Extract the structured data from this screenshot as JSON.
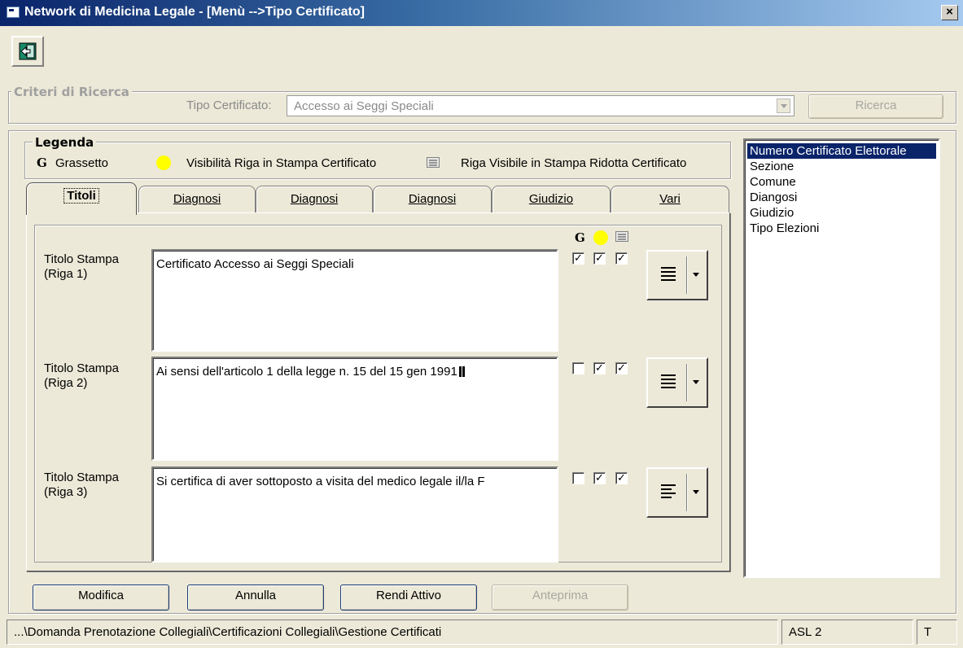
{
  "window": {
    "title": "Network di Medicina Legale - [Menù -->Tipo Certificato]",
    "close_label": "×"
  },
  "toolbar": {
    "exit_icon": "exit-door-icon"
  },
  "search": {
    "group_label": "Criteri di Ricerca",
    "tipo_label": "Tipo Certificato:",
    "tipo_value": "Accesso ai Seggi Speciali",
    "search_button": "Ricerca"
  },
  "legenda": {
    "title": "Legenda",
    "g_symbol": "G",
    "g_text": "Grassetto",
    "visible_text": "Visibilità Riga in Stampa Certificato",
    "reduced_text": "Riga Visibile in Stampa Ridotta Certificato"
  },
  "tabs": [
    {
      "label": "Titoli",
      "active": true
    },
    {
      "label": "Diagnosi",
      "active": false
    },
    {
      "label": "Diagnosi",
      "active": false
    },
    {
      "label": "Diagnosi",
      "active": false
    },
    {
      "label": "Giudizio",
      "active": false
    },
    {
      "label": "Vari",
      "active": false
    }
  ],
  "column_header": {
    "g": "G"
  },
  "rows": [
    {
      "label_line1": "Titolo Stampa",
      "label_line2": "(Riga 1)",
      "text": "Certificato Accesso ai Seggi Speciali",
      "bold_checked": true,
      "visible_checked": true,
      "reduced_checked": true,
      "alignment": "justify"
    },
    {
      "label_line1": "Titolo Stampa",
      "label_line2": "(Riga 2)",
      "text": "Ai sensi dell'articolo 1 della legge n. 15 del 15 gen 1991",
      "bold_checked": false,
      "visible_checked": true,
      "reduced_checked": true,
      "alignment": "justify"
    },
    {
      "label_line1": "Titolo Stampa",
      "label_line2": "(Riga 3)",
      "text": "Si certifica di aver sottoposto a visita del medico legale il/la F",
      "bold_checked": false,
      "visible_checked": true,
      "reduced_checked": true,
      "alignment": "left"
    }
  ],
  "fields_list": {
    "items": [
      "Numero Certificato Elettorale",
      "Sezione",
      "Comune",
      "Diangosi",
      "Giudizio",
      "Tipo Elezioni"
    ],
    "selected_index": 0
  },
  "actions": {
    "modifica": "Modifica",
    "annulla": "Annulla",
    "rendi_attivo": "Rendi Attivo",
    "anteprima": "Anteprima"
  },
  "status": {
    "path": "...\\Domanda Prenotazione Collegiali\\Certificazioni Collegiali\\Gestione Certificati",
    "asl": "ASL 2",
    "mode": "T"
  },
  "colors": {
    "title_bar": "#0a246a",
    "selection": "#0a246a",
    "legend_dot": "#ffff00"
  }
}
